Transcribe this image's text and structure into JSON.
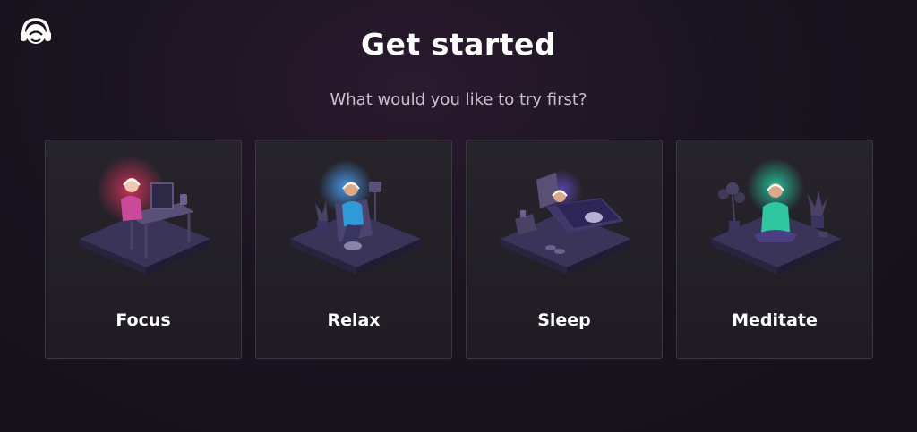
{
  "app": {
    "logo_icon": "headphones-face-icon"
  },
  "header": {
    "title": "Get started",
    "subtitle": "What would you like to try first?"
  },
  "options": [
    {
      "label": "Focus",
      "icon": "person-at-desk-illustration",
      "glow": "#e0365f"
    },
    {
      "label": "Relax",
      "icon": "person-in-armchair-illustration",
      "glow": "#4fa8ff"
    },
    {
      "label": "Sleep",
      "icon": "person-in-bed-illustration",
      "glow": "#7a5cff"
    },
    {
      "label": "Meditate",
      "icon": "person-meditating-illustration",
      "glow": "#27d6a6"
    }
  ]
}
